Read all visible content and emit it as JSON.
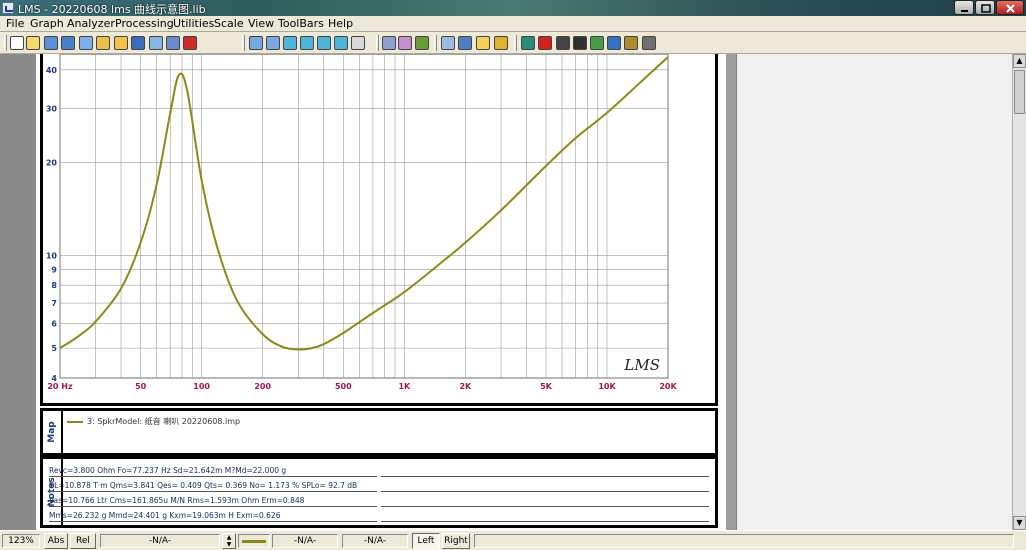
{
  "window": {
    "title": "LMS - 20220608 lms 曲线示意图.lib",
    "buttons": [
      "minimize",
      "maximize",
      "close"
    ]
  },
  "menu": {
    "items": [
      {
        "label": "File",
        "key": "F"
      },
      {
        "label": "Graph",
        "key": "G"
      },
      {
        "label": "Analyzer",
        "key": "A"
      },
      {
        "label": "Processing",
        "key": "P"
      },
      {
        "label": "Utilities",
        "key": "U"
      },
      {
        "label": "Scale",
        "key": "S"
      },
      {
        "label": "View",
        "key": "V"
      },
      {
        "label": "ToolBars",
        "key": "B"
      },
      {
        "label": "Help",
        "key": "H"
      }
    ]
  },
  "toolbar": {
    "icons": [
      "new-icon",
      "open-icon",
      "save-icon",
      "save-as-icon",
      "save-all-icon",
      "print-setup-icon",
      "folder-icon",
      "printer-icon",
      "preview-icon",
      "edit-icon",
      "record-icon",
      "zoom-in-icon",
      "zoom-out-icon",
      "zoom-1-icon",
      "zoom-2-icon",
      "zoom-3-icon",
      "zoom-4-icon",
      "grid-icon",
      "table-icon",
      "pattern-icon",
      "undo-icon",
      "layout-icon",
      "frame-icon",
      "yellow-box-icon",
      "star-icon",
      "chip-icon",
      "red-stop-icon",
      "circle-icon",
      "disk-icon",
      "pen-icon",
      "target-icon",
      "gear-icon",
      "tool-icon"
    ]
  },
  "chart_data": {
    "type": "line",
    "title": "",
    "xlabel": "",
    "ylabel": "",
    "xscale": "log",
    "yscale": "log",
    "xlim": [
      20,
      20000
    ],
    "ylim": [
      4,
      45
    ],
    "x_tick_labels": [
      "20 Hz",
      "50",
      "100",
      "200",
      "500",
      "1K",
      "2K",
      "5K",
      "10K",
      "20K"
    ],
    "y_tick_labels": [
      "40",
      "30",
      "20",
      "10",
      "9",
      "8",
      "7",
      "6",
      "5",
      "4"
    ],
    "grid": true,
    "watermark": "LMS",
    "series": [
      {
        "name": "3: SpkrModel: 纸音 喇叭 20220608.imp",
        "color": "#8a8a1a",
        "x": [
          20,
          25,
          30,
          40,
          50,
          60,
          70,
          77.2,
          85,
          100,
          120,
          150,
          200,
          250,
          300,
          350,
          400,
          500,
          700,
          1000,
          1500,
          2000,
          3000,
          5000,
          7000,
          10000,
          15000,
          20000
        ],
        "y": [
          5.0,
          5.5,
          6.1,
          7.8,
          11.0,
          17.0,
          29.0,
          38.5,
          34.0,
          17.5,
          10.5,
          7.1,
          5.55,
          5.05,
          4.95,
          5.0,
          5.15,
          5.6,
          6.5,
          7.6,
          9.4,
          11.0,
          14.0,
          19.5,
          24.0,
          29.0,
          37.0,
          44.0
        ]
      }
    ]
  },
  "map": {
    "label": "Map",
    "entry": "3: SpkrModel: 纸音 喇叭 20220608.imp"
  },
  "notes": {
    "label": "Notes",
    "lines": [
      "Revc=3.800 Ohm  Fo=77.237 Hz  Sd=21.642m M?Md=22.000 g",
      "BL=10.878 T·m  Qms=3.841  Qes= 0.409  Qts= 0.369  No= 1.173 %  SPLo= 92.7 dB",
      "Vas=10.766 Ltr  Cms=161.865u M/N  Rms=1.593m Ohm  Erm=0.848",
      "Mms=26.232 g  Mmd=24.401 g  Kxm=19.063m H  Exm=0.626"
    ]
  },
  "statusbar": {
    "zoom": "123%",
    "abs": "Abs",
    "rel": "Rel",
    "field1": "-N/A-",
    "field2": "-N/A-",
    "field3": "-N/A-",
    "left": "Left",
    "right": "Right"
  }
}
